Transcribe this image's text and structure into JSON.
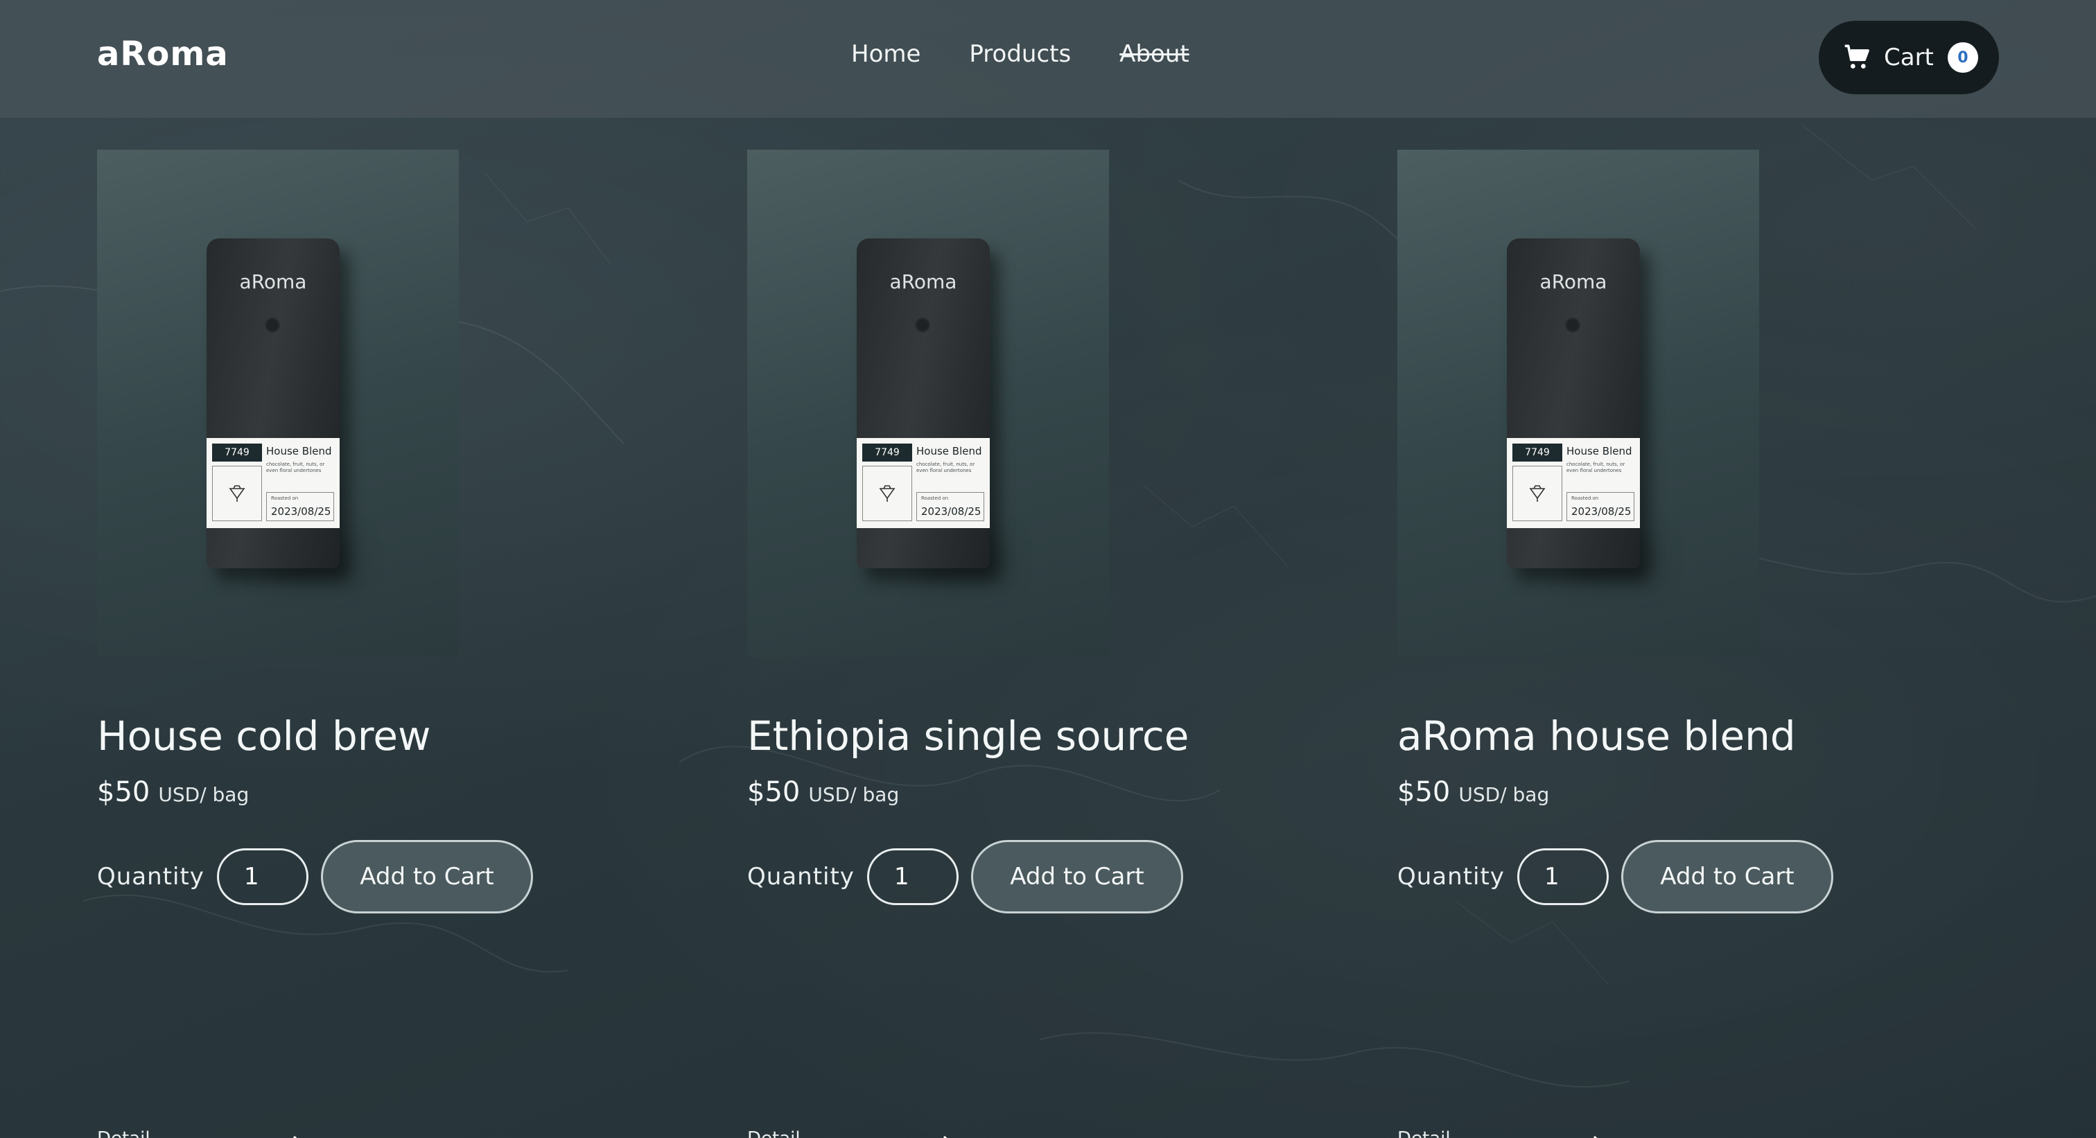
{
  "app": {
    "brand": "aRoma"
  },
  "nav": {
    "items": [
      {
        "label": "Home",
        "struck": false
      },
      {
        "label": "Products",
        "struck": false
      },
      {
        "label": "About",
        "struck": true
      }
    ]
  },
  "cart": {
    "label": "Cart",
    "count": "0",
    "icon": "cart-icon"
  },
  "products": [
    {
      "title": "House cold brew",
      "price": "$50",
      "unit": "USD/ bag",
      "quantity_label": "Quantity",
      "quantity": "1",
      "add_label": "Add to Cart",
      "detail_label": "Detail",
      "bag": {
        "logo": "aRoma",
        "number": "7749",
        "name": "House Blend",
        "desc": "chocolate, fruit, nuts, or even floral undertones",
        "roasted_label": "Roasted on",
        "date": "2023/08/25"
      }
    },
    {
      "title": "Ethiopia single source",
      "price": "$50",
      "unit": "USD/ bag",
      "quantity_label": "Quantity",
      "quantity": "1",
      "add_label": "Add to Cart",
      "detail_label": "Detail",
      "bag": {
        "logo": "aRoma",
        "number": "7749",
        "name": "House Blend",
        "desc": "chocolate, fruit, nuts, or even floral undertones",
        "roasted_label": "Roasted on",
        "date": "2023/08/25"
      }
    },
    {
      "title": "aRoma house blend",
      "price": "$50",
      "unit": "USD/ bag",
      "quantity_label": "Quantity",
      "quantity": "1",
      "add_label": "Add to Cart",
      "detail_label": "Detail",
      "bag": {
        "logo": "aRoma",
        "number": "7749",
        "name": "House Blend",
        "desc": "chocolate, fruit, nuts, or even floral undertones",
        "roasted_label": "Roasted on",
        "date": "2023/08/25"
      }
    }
  ],
  "colors": {
    "background": "#2a383d",
    "header": "#4e5a5e",
    "cart_bg": "#151c1f",
    "cart_badge_text": "#2e6fbf",
    "button_bg": "#4b5a5e"
  }
}
